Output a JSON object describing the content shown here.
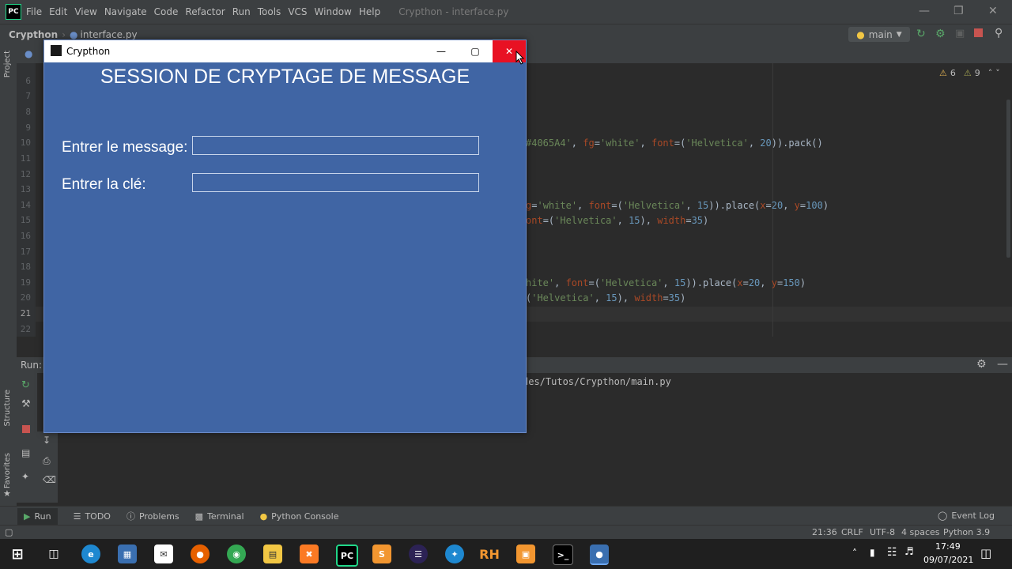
{
  "ide": {
    "menu": [
      "File",
      "Edit",
      "View",
      "Navigate",
      "Code",
      "Refactor",
      "Run",
      "Tools",
      "VCS",
      "Window",
      "Help"
    ],
    "window_title": "Crypthon - interface.py",
    "breadcrumb_project": "Crypthon",
    "breadcrumb_file": "interface.py",
    "branch": "main",
    "left_strip": {
      "project": "Project",
      "structure": "Structure",
      "favorites": "Favorites"
    },
    "inspections": {
      "warnings": "6",
      "weak_warnings": "9"
    },
    "line_numbers": [
      "6",
      "7",
      "8",
      "9",
      "10",
      "11",
      "12",
      "13",
      "14",
      "15",
      "16",
      "17",
      "18",
      "19",
      "20",
      "21",
      "22"
    ],
    "code_lines": {
      "l10": {
        "a": "#4065A4'",
        "b": ", ",
        "c": "fg",
        "d": "=",
        "e": "'white'",
        "f": ", ",
        "g": "font",
        "h": "=(",
        "i": "'Helvetica'",
        "j": ", ",
        "k": "20",
        "l": ")).pack()"
      },
      "l14": {
        "a": "g",
        "b": "=",
        "c": "'white'",
        "d": ", ",
        "e": "font",
        "f": "=(",
        "g": "'Helvetica'",
        "h": ", ",
        "i": "15",
        "j": ")).place(",
        "k": "x",
        "l": "=",
        "m": "20",
        "n": ", ",
        "o": "y",
        "p": "=",
        "q": "100",
        "r": ")"
      },
      "l15": {
        "a": "ont",
        "b": "=(",
        "c": "'Helvetica'",
        "d": ", ",
        "e": "15",
        "f": "), ",
        "g": "width",
        "h": "=",
        "i": "35",
        "j": ")"
      },
      "l19": {
        "a": "hite'",
        "b": ", ",
        "c": "font",
        "d": "=(",
        "e": "'Helvetica'",
        "f": ", ",
        "g": "15",
        "h": ")).place(",
        "i": "x",
        "j": "=",
        "k": "20",
        "l": ", ",
        "m": "y",
        "n": "=",
        "o": "150",
        "p": ")"
      },
      "l20": {
        "a": "(",
        "b": "'Helvetica'",
        "c": ", ",
        "d": "15",
        "e": "), ",
        "f": "width",
        "g": "=",
        "h": "35",
        "i": ")"
      }
    },
    "run_label": "Run:",
    "run_output": "des/Tutos/Crypthon/main.py",
    "tool_windows": {
      "run": "Run",
      "todo": "TODO",
      "problems": "Problems",
      "terminal": "Terminal",
      "console": "Python Console",
      "event_log": "Event Log"
    },
    "status": {
      "position": "21:36",
      "line_sep": "CRLF",
      "encoding": "UTF-8",
      "indent": "4 spaces",
      "interpreter": "Python 3.9"
    }
  },
  "tk_window": {
    "title": "Crypthon",
    "heading": "SESSION DE CRYPTAGE DE MESSAGE",
    "message_label": "Entrer le message:",
    "key_label": "Entrer la clé:",
    "message_value": "",
    "key_value": ""
  },
  "taskbar": {
    "time": "17:49",
    "date": "09/07/2021",
    "rh_label": "RH"
  },
  "colors": {
    "tk_bg": "#4065A4",
    "close_red": "#e81123",
    "ide_bg": "#2b2b2b"
  }
}
